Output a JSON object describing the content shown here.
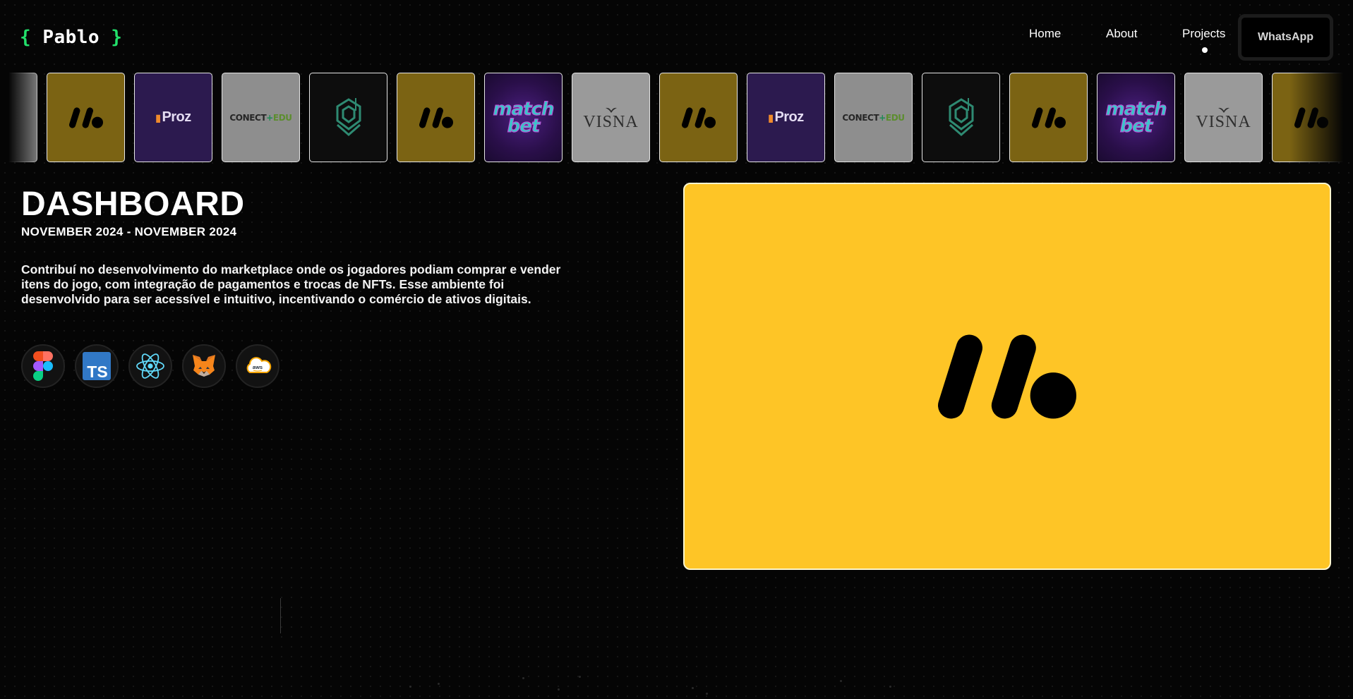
{
  "header": {
    "logo": {
      "open_brace": "{",
      "name": "Pablo",
      "close_brace": "}"
    },
    "nav": {
      "home": "Home",
      "about": "About",
      "projects": "Projects",
      "active": "projects"
    },
    "whatsapp_label": "WhatsApp"
  },
  "carousel": {
    "items": [
      {
        "brand": "unknown",
        "visible": "partial"
      },
      {
        "brand": "marketplace",
        "theme": "yellow"
      },
      {
        "brand": "proz",
        "label": "Proz",
        "theme": "purple"
      },
      {
        "brand": "conect-edu",
        "label_a": "CONECT",
        "label_plus": "+",
        "label_b": "EDU",
        "theme": "gray"
      },
      {
        "brand": "shield",
        "theme": "dark"
      },
      {
        "brand": "marketplace",
        "theme": "yellow"
      },
      {
        "brand": "matchbet",
        "label_a": "match",
        "label_b": "bet",
        "theme": "purple"
      },
      {
        "brand": "visna",
        "label": "VISNA",
        "theme": "gray"
      },
      {
        "brand": "marketplace",
        "theme": "yellow"
      },
      {
        "brand": "proz",
        "label": "Proz",
        "theme": "purple"
      },
      {
        "brand": "conect-edu",
        "label_a": "CONECT",
        "label_plus": "+",
        "label_b": "EDU",
        "theme": "gray"
      },
      {
        "brand": "shield",
        "theme": "dark"
      },
      {
        "brand": "marketplace",
        "theme": "yellow"
      },
      {
        "brand": "matchbet",
        "label_a": "match",
        "label_b": "bet",
        "theme": "purple"
      },
      {
        "brand": "visna",
        "label": "VISNA",
        "theme": "gray"
      },
      {
        "brand": "marketplace",
        "theme": "yellow",
        "visible": "partial"
      }
    ]
  },
  "project": {
    "title": "DASHBOARD",
    "dates": "NOVEMBER 2024 - NOVEMBER 2024",
    "description": "Contribuí no desenvolvimento do marketplace onde os jogadores podiam comprar e vender itens do jogo, com integração de pagamentos e trocas de NFTs. Esse ambiente foi desenvolvido para ser acessível e intuitivo, incentivando o comércio de ativos digitais.",
    "technologies": [
      {
        "icon": "figma-icon"
      },
      {
        "icon": "typescript-icon",
        "label": "TS"
      },
      {
        "icon": "react-icon"
      },
      {
        "icon": "metamask-icon"
      },
      {
        "icon": "aws-icon",
        "label": "aws"
      }
    ]
  },
  "colors": {
    "accent_green": "#22e06b",
    "preview_yellow": "#fec526",
    "background": "#050505",
    "typescript_blue": "#3178c6",
    "react_cyan": "#61dafb"
  }
}
